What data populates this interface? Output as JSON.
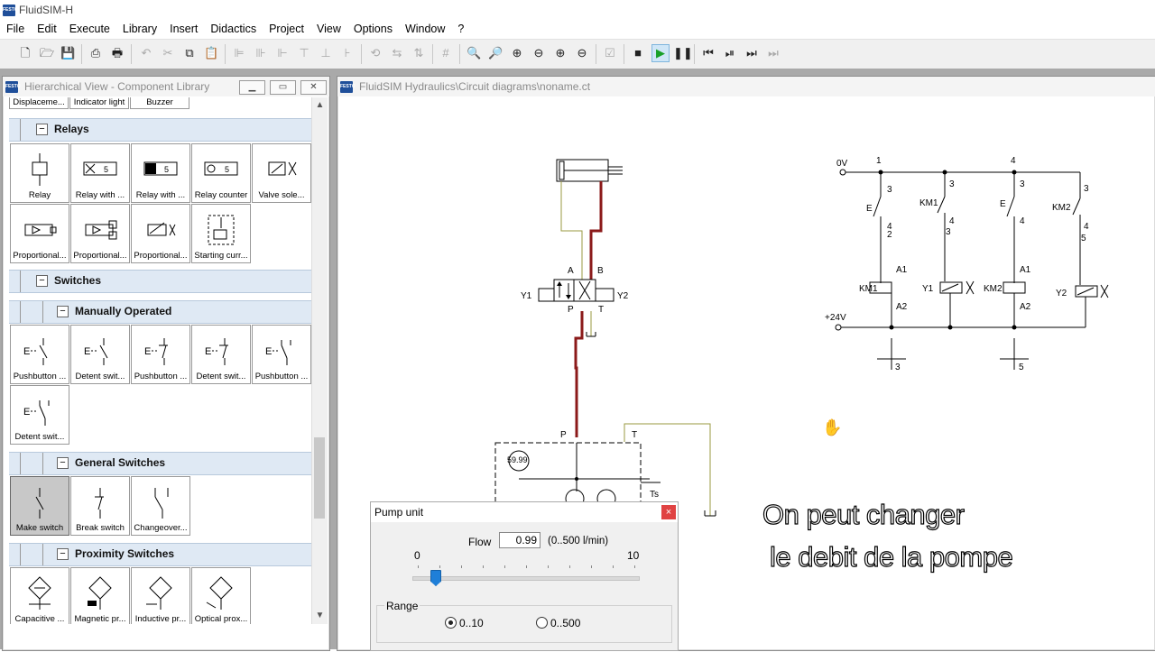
{
  "app": {
    "title": "FluidSIM-H",
    "logo_text": "FESTO"
  },
  "menu": [
    "File",
    "Edit",
    "Execute",
    "Library",
    "Insert",
    "Didactics",
    "Project",
    "View",
    "Options",
    "Window",
    "?"
  ],
  "library_window": {
    "title": "Hierarchical View - Component Library",
    "top_stubs": [
      "Displaceme...",
      "Indicator light",
      "Buzzer"
    ],
    "sections": {
      "relays": {
        "label": "Relays",
        "items": [
          "Relay",
          "Relay with ...",
          "Relay with ...",
          "Relay counter",
          "Valve sole...",
          "Proportional...",
          "Proportional...",
          "Proportional...",
          "Starting curr..."
        ]
      },
      "switches": {
        "label": "Switches"
      },
      "manually_operated": {
        "label": "Manually Operated",
        "items": [
          "Pushbutton ...",
          "Detent swit...",
          "Pushbutton ...",
          "Detent swit...",
          "Pushbutton ...",
          "Detent swit..."
        ]
      },
      "general_switches": {
        "label": "General Switches",
        "items": [
          "Make switch",
          "Break switch",
          "Changeover..."
        ]
      },
      "proximity_switches": {
        "label": "Proximity Switches",
        "items": [
          "Capacitive ...",
          "Magnetic pr...",
          "Inductive pr...",
          "Optical prox..."
        ]
      }
    }
  },
  "circuit_window": {
    "title": "FluidSIM Hydraulics\\Circuit diagrams\\noname.ct"
  },
  "hydraulic": {
    "port_a": "A",
    "port_b": "B",
    "port_p": "P",
    "port_t": "T",
    "y1": "Y1",
    "y2": "Y2",
    "pump_p": "P",
    "pump_t": "T",
    "gauge": "59.99",
    "ts": "Ts"
  },
  "electrical": {
    "zero_v": "0V",
    "plus_24v": "+24V",
    "n1": "1",
    "n4": "4",
    "c3a": "3",
    "c3b": "3",
    "c3c": "3",
    "c3d": "3",
    "c4a": "4",
    "c2a": "2",
    "c4b": "4",
    "c3e": "3",
    "c4c": "4",
    "c4d": "4",
    "c4e": "4",
    "c2b": "5",
    "km1_contact": "KM1",
    "km2_contact": "KM2",
    "a1a": "A1",
    "a2a": "A2",
    "a1b": "A1",
    "a2b": "A2",
    "km1": "KM1",
    "y1": "Y1",
    "km2": "KM2",
    "y2": "Y2",
    "ref_left": "3",
    "ref_right": "5"
  },
  "pump_dialog": {
    "title": "Pump unit",
    "flow_label": "Flow",
    "flow_value": "0.99",
    "flow_range": "(0..500 l/min)",
    "scale_min": "0",
    "scale_max": "10",
    "slider_fraction": 0.1,
    "range_label": "Range",
    "options": [
      "0..10",
      "0..500"
    ],
    "selected_option": "0..10"
  },
  "caption": {
    "line1": "On peut changer",
    "line2": "le debit de la pompe"
  }
}
